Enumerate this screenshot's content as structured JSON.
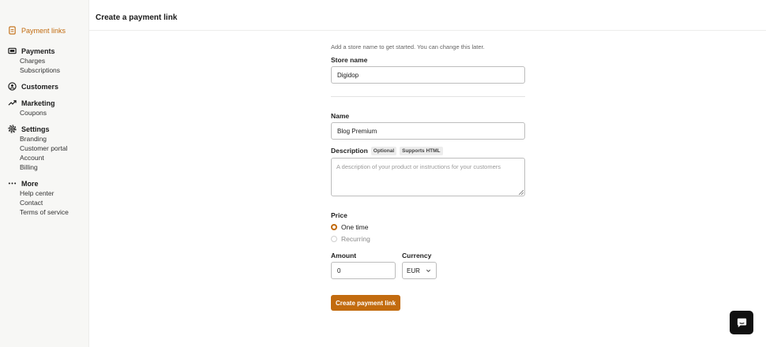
{
  "sidebar": {
    "payment_links": "Payment links",
    "payments": {
      "label": "Payments",
      "items": [
        "Charges",
        "Subscriptions"
      ]
    },
    "customers": "Customers",
    "marketing": {
      "label": "Marketing",
      "items": [
        "Coupons"
      ]
    },
    "settings": {
      "label": "Settings",
      "items": [
        "Branding",
        "Customer portal",
        "Account",
        "Billing"
      ]
    },
    "more": {
      "label": "More",
      "items": [
        "Help center",
        "Contact",
        "Terms of service"
      ]
    }
  },
  "header": {
    "title": "Create a payment link"
  },
  "form": {
    "hint": "Add a store name to get started. You can change this later.",
    "store_name_label": "Store name",
    "store_name_value": "Digidop",
    "name_label": "Name",
    "name_value": "Blog Premium",
    "description_label": "Description",
    "optional_tag": "Optional",
    "html_tag": "Supports HTML",
    "description_placeholder": "A description of your product or instructions for your customers",
    "price_label": "Price",
    "price_options": [
      "One time",
      "Recurring"
    ],
    "price_selected": "One time",
    "amount_label": "Amount",
    "amount_value": "0",
    "currency_label": "Currency",
    "currency_value": "EUR",
    "submit_label": "Create payment link"
  },
  "colors": {
    "accent": "#c26b0f",
    "sidebar_bg": "#f7f7f5"
  },
  "icons": {
    "chat": "chat-bubble-icon"
  }
}
